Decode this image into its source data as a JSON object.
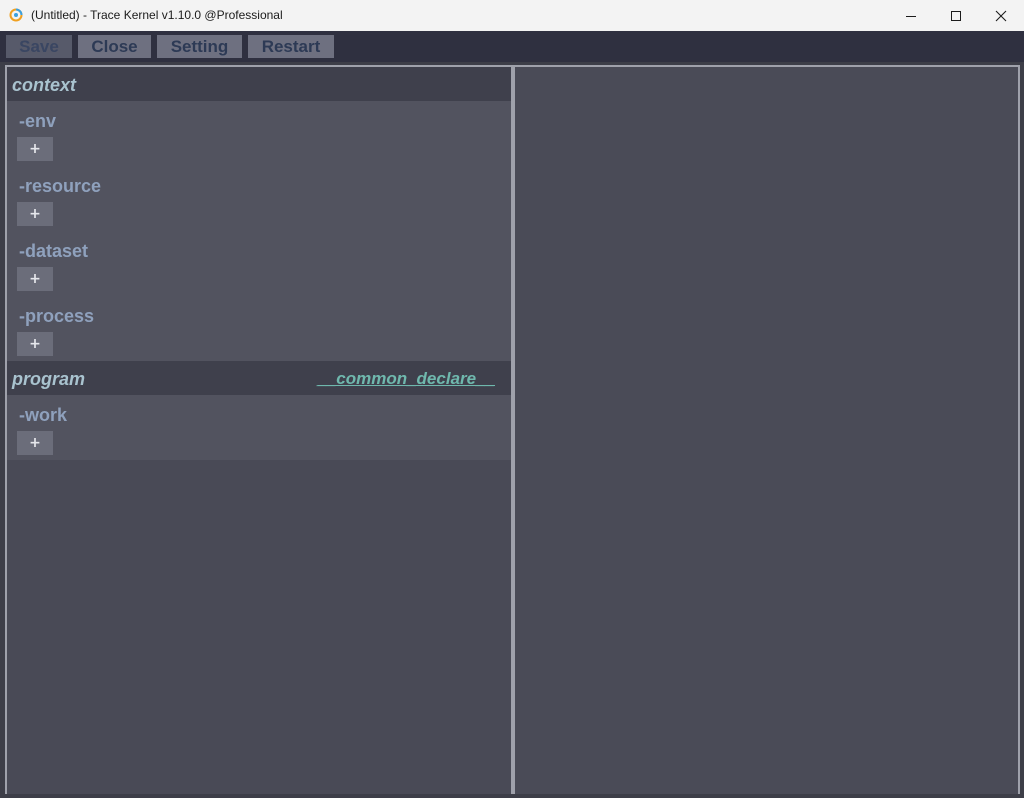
{
  "window": {
    "title": "(Untitled) - Trace Kernel v1.10.0 @Professional",
    "app_icon": "trace-kernel-logo-icon",
    "controls": {
      "minimize_icon": "minimize-icon",
      "maximize_icon": "maximize-icon",
      "close_icon": "close-icon"
    }
  },
  "toolbar": {
    "save_label": "Save",
    "close_label": "Close",
    "setting_label": "Setting",
    "restart_label": "Restart"
  },
  "left_pane": {
    "context": {
      "title": "context",
      "items": [
        {
          "label": "-env",
          "add_label": "+"
        },
        {
          "label": "-resource",
          "add_label": "+"
        },
        {
          "label": "-dataset",
          "add_label": "+"
        },
        {
          "label": "-process",
          "add_label": "+"
        }
      ]
    },
    "program": {
      "title": "program",
      "link": "__common_declare__",
      "items": [
        {
          "label": "-work",
          "add_label": "+"
        }
      ]
    }
  },
  "colors": {
    "background": "#3d3e48",
    "toolbar": "#2f3040",
    "section_header": "#3f404c",
    "section_body": "#52535f",
    "section_title": "#a9c3cf",
    "item_label": "#8fa1bd",
    "link": "#6fb8ad"
  }
}
